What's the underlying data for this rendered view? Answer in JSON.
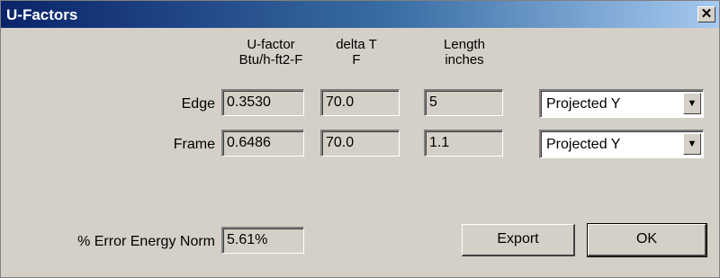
{
  "window": {
    "title": "U-Factors",
    "close_label": "✕"
  },
  "columns": {
    "ufactor": {
      "line1": "U-factor",
      "line2": "Btu/h-ft2-F"
    },
    "deltat": {
      "line1": "delta T",
      "line2": "F"
    },
    "length": {
      "line1": "Length",
      "line2": "inches"
    }
  },
  "rows": [
    {
      "label": "Edge",
      "ufactor": "0.3530",
      "deltat": "70.0",
      "length": "5",
      "projection": "Projected Y"
    },
    {
      "label": "Frame",
      "ufactor": "0.6486",
      "deltat": "70.0",
      "length": "1.1",
      "projection": "Projected Y"
    }
  ],
  "error": {
    "label": "% Error Energy Norm",
    "value": "5.61%"
  },
  "buttons": {
    "export": "Export",
    "ok": "OK"
  },
  "icons": {
    "close": "close-icon",
    "dropdown": "chevron-down-icon"
  }
}
